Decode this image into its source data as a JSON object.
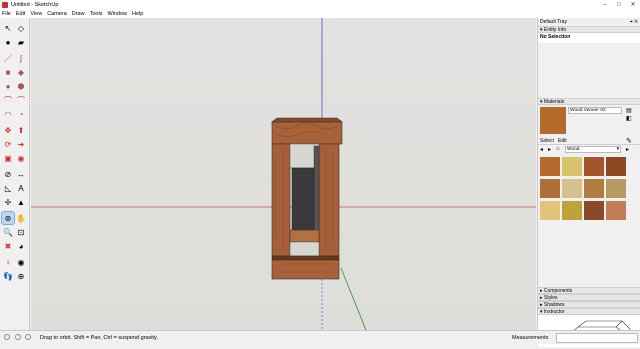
{
  "window": {
    "title": "Untitled - SketchUp"
  },
  "menu": [
    "File",
    "Edit",
    "View",
    "Camera",
    "Draw",
    "Tools",
    "Window",
    "Help"
  ],
  "tray": {
    "title": "Default Tray",
    "entity_info": {
      "header": "Entity Info",
      "selection": "No Selection"
    },
    "materials": {
      "header": "Materials",
      "current_name": "Wood Veneer 02",
      "tabs": [
        "Select",
        "Edit"
      ],
      "collection": "Wood",
      "swatch_colors": [
        "#b5692b",
        "#d8c36a",
        "#a4552a",
        "#8d4a22",
        "#b06f36",
        "#d6c08c",
        "#b17d3e",
        "#b59a63",
        "#e3c27a",
        "#c0a23b",
        "#8a4a2a",
        "#c47c57"
      ]
    },
    "collapsed_panels": [
      "Components",
      "Styles",
      "Shadows",
      "Instructor"
    ]
  },
  "status": {
    "hint": "Drag to orbit. Shift = Pan, Ctrl = suspend gravity.",
    "measurements_label": "Measurements"
  },
  "colors": {
    "wood": "#a8623a",
    "wood_dark": "#7a3f22",
    "axis_red": "#c54a4a",
    "axis_green": "#3a9a3a",
    "axis_blue": "#4c4cd0"
  }
}
